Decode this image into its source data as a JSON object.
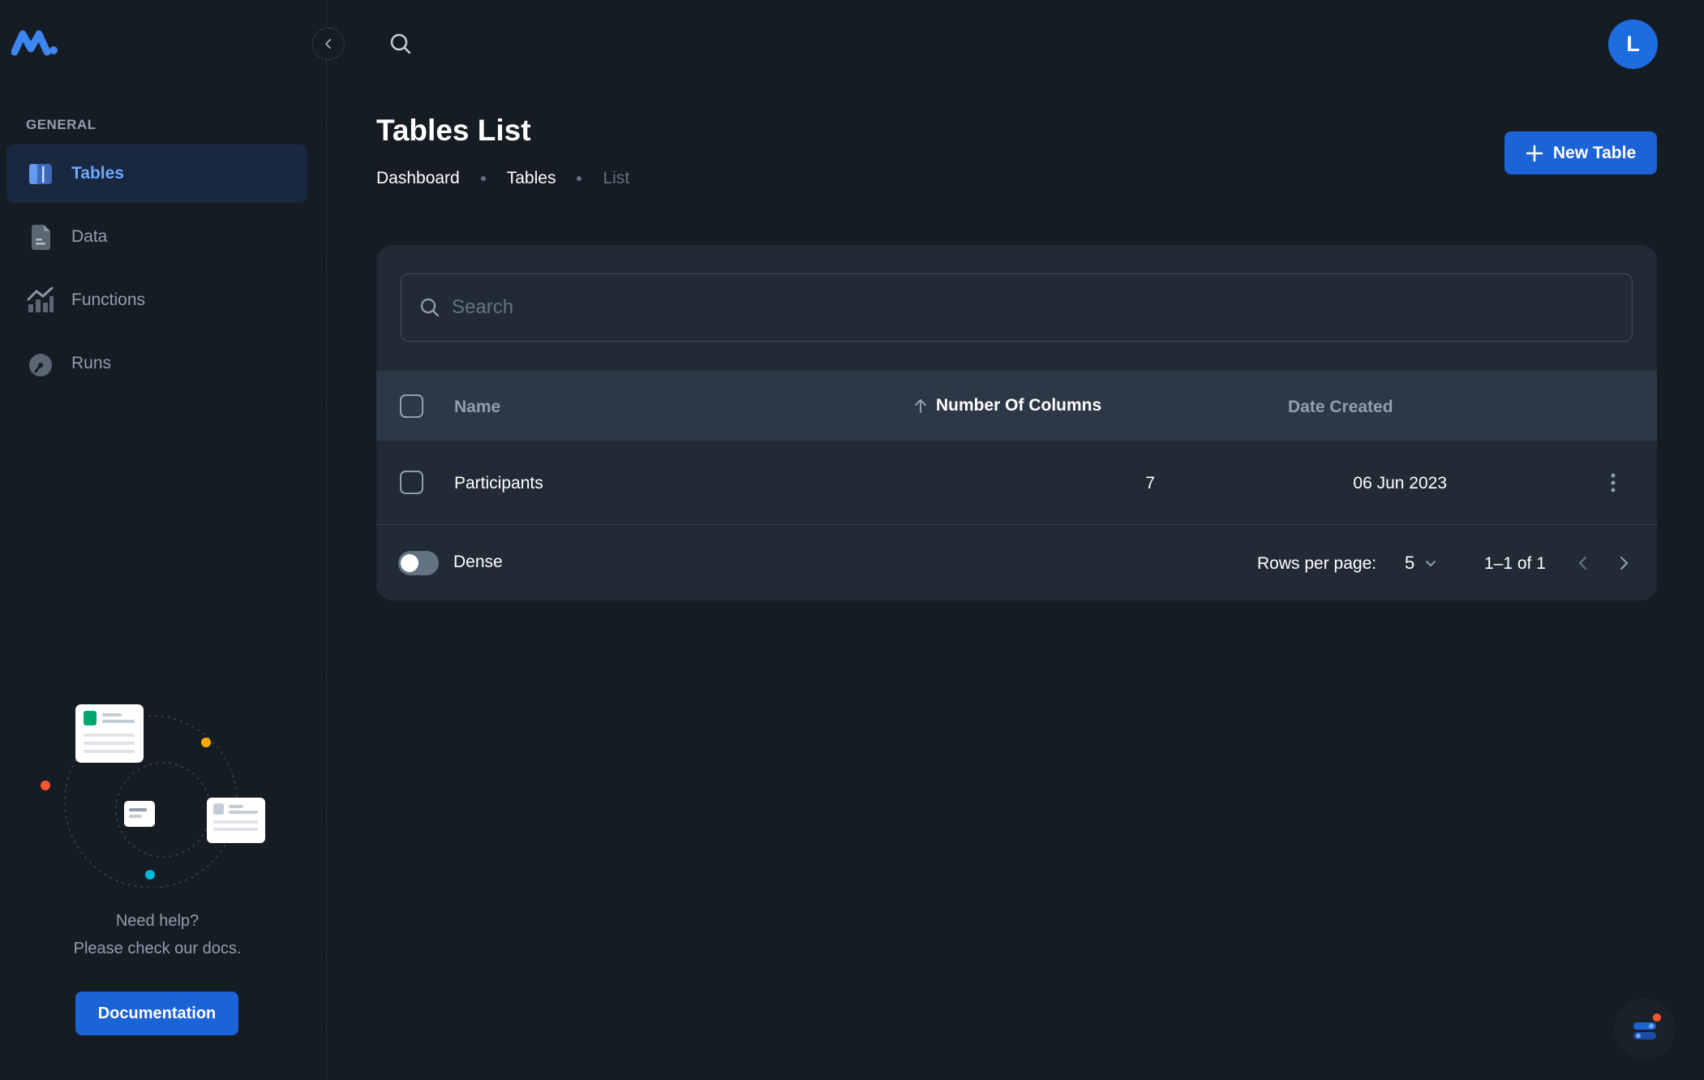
{
  "sidebar": {
    "section_label": "GENERAL",
    "items": [
      {
        "label": "Tables",
        "icon": "folder-icon",
        "active": true
      },
      {
        "label": "Data",
        "icon": "document-icon",
        "active": false
      },
      {
        "label": "Functions",
        "icon": "chart-icon",
        "active": false
      },
      {
        "label": "Runs",
        "icon": "speedometer-icon",
        "active": false
      }
    ],
    "help_line1": "Need help?",
    "help_line2": "Please check our docs.",
    "doc_button": "Documentation"
  },
  "header": {
    "avatar_letter": "L"
  },
  "page": {
    "title": "Tables List",
    "breadcrumb": [
      "Dashboard",
      "Tables",
      "List"
    ],
    "new_button": "New Table"
  },
  "table": {
    "search_placeholder": "Search",
    "columns": {
      "name": "Name",
      "num_columns": "Number Of Columns",
      "date_created": "Date Created"
    },
    "rows": [
      {
        "name": "Participants",
        "num_columns": "7",
        "date_created": "06 Jun 2023"
      }
    ],
    "dense_label": "Dense",
    "rows_per_page_label": "Rows per page:",
    "rows_per_page_value": "5",
    "range": "1–1 of 1"
  },
  "colors": {
    "background": "#161c24",
    "card": "#212b36",
    "primary": "#1c63d6",
    "active_nav": "#6ea8fe"
  }
}
